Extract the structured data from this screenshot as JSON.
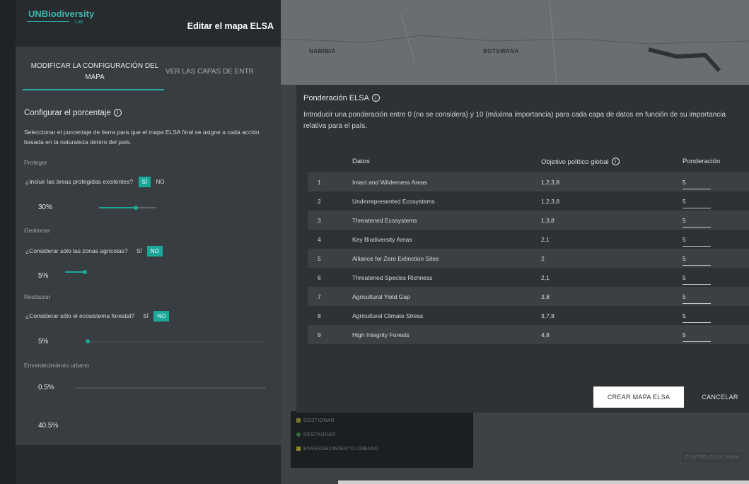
{
  "header": {
    "logo_text": "UNBiodiversity",
    "logo_sub": "Lab",
    "title": "Editar el mapa ELSA"
  },
  "tabs": [
    {
      "label": "MODIFICAR LA CONFIGURACIÓN DEL MAPA",
      "active": true
    },
    {
      "label": "VER LAS CAPAS DE ENTR",
      "active": false
    }
  ],
  "config": {
    "title": "Configurar el porcentaje",
    "description": "Seleccionar el porcentaje de tierra para que el mapa ELSA final se asigne a cada acción basada en la naturaleza dentro del país.",
    "sections": [
      {
        "label": "Proteger",
        "question": "¿Incluir las áreas protegidas existentes?",
        "yes": "SÍ",
        "no": "NO",
        "selected": "SÍ",
        "percent": "30%",
        "level": 0.3
      },
      {
        "label": "Gestionar",
        "question": "¿Considerar sólo las zonas agrícolas?",
        "yes": "SÍ",
        "no": "NO",
        "selected": "NO",
        "percent": "5%",
        "level": 0.05
      },
      {
        "label": "Restaurar",
        "question": "¿Considerar sólo el ecosistema forestal?",
        "yes": "SÍ",
        "no": "NO",
        "selected": "NO",
        "percent": "5%",
        "level": 0.05
      },
      {
        "label": "Enverdecimiento urbano",
        "percent": "0.5%",
        "level": 0.005
      }
    ],
    "total": "40.5%"
  },
  "map": {
    "labels": [
      "NAMIBIA",
      "BOTSWANA"
    ],
    "legend": [
      "GESTIONAR",
      "RESTAURAR",
      "ENVERDECIMIENTO URBANO"
    ],
    "legend_colors": [
      "#7a7a26",
      "#2f6b3a",
      "#8a8a2a"
    ],
    "controls": "CONTROLES DE MAPA"
  },
  "modal": {
    "title": "Ponderación ELSA",
    "description": "Introducir una ponderación entre 0 (no se considera) y 10 (máxima importancia) para cada capa de datos en función de su importancia relativa para el país.",
    "columns": [
      "Datos",
      "Objetivo político global",
      "Ponderación"
    ],
    "rows": [
      {
        "num": "1",
        "name": "Intact and Wilderness Areas",
        "goal": "1,2,3,8",
        "weight": "5"
      },
      {
        "num": "2",
        "name": "Underrepresented Ecosystems",
        "goal": "1,2,3,8",
        "weight": "5"
      },
      {
        "num": "3",
        "name": "Threatened Ecosystems",
        "goal": "1,3,8",
        "weight": "5"
      },
      {
        "num": "4",
        "name": "Key Biodiversity Areas",
        "goal": "2,1",
        "weight": "5"
      },
      {
        "num": "5",
        "name": "Alliance for Zero Extinction Sites",
        "goal": "2",
        "weight": "5"
      },
      {
        "num": "6",
        "name": "Threatened Species Richness",
        "goal": "2,1",
        "weight": "5"
      },
      {
        "num": "7",
        "name": "Agricultural Yield Gap",
        "goal": "3,8",
        "weight": "5"
      },
      {
        "num": "8",
        "name": "Agricultural Climate Stress",
        "goal": "3,7,8",
        "weight": "5"
      },
      {
        "num": "9",
        "name": "High Integrity Forests",
        "goal": "4,8",
        "weight": "5"
      }
    ],
    "create_label": "CREAR MAPA ELSA",
    "cancel_label": "CANCELAR"
  }
}
